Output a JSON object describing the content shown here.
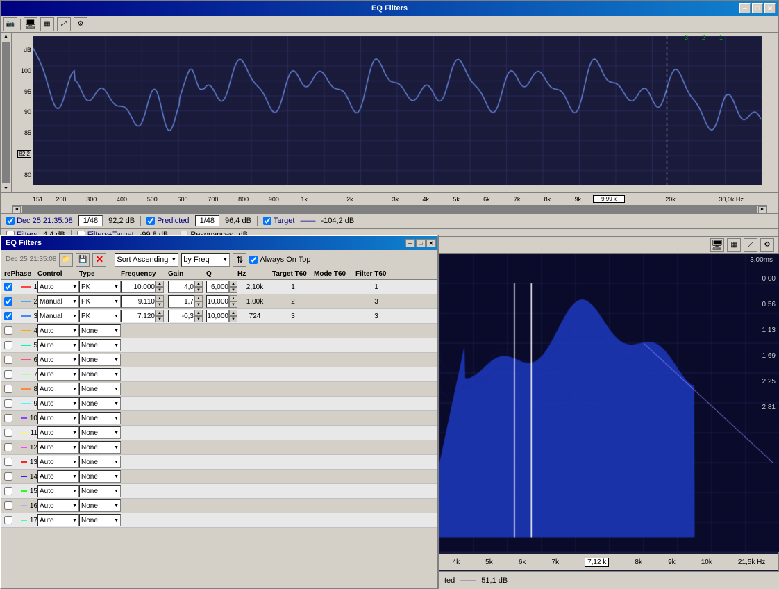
{
  "mainWindow": {
    "title": "EQ Filters",
    "toolbar": {
      "icons": [
        "camera",
        "restore",
        "maximize"
      ]
    },
    "chart": {
      "yAxis": {
        "label": "dB",
        "values": [
          100,
          95,
          90,
          85,
          80
        ]
      },
      "xAxis": {
        "values": [
          "151",
          "200",
          "300",
          "400",
          "500",
          "600",
          "700",
          "800",
          "900",
          "1k",
          "2k",
          "3k",
          "4k",
          "5k",
          "6k",
          "7k",
          "8k",
          "9k",
          "9,99k",
          "20k",
          "30,0k Hz"
        ]
      },
      "topMarkers": [
        "3",
        "2",
        "1"
      ],
      "currentFreq": "9,99 k"
    },
    "checkboxRow1": {
      "dec25Label": "Dec 25 21:35:08",
      "smoothing1": "1/48",
      "value1": "92,2 dB",
      "predictedLabel": "Predicted",
      "smoothing2": "1/48",
      "value2": "96,4 dB",
      "targetLabel": "Target",
      "line": "—",
      "value3": "-104,2 dB"
    },
    "checkboxRow2": {
      "filtersLabel": "Filters",
      "value4": "4,4 dB",
      "filtersTargetLabel": "Filters+Target",
      "value5": "-99,8 dB",
      "resonancesLabel": "Resonances",
      "value6": "dB"
    }
  },
  "eqWindow": {
    "title": "EQ Filters",
    "date": "Dec 25 21:35:08",
    "toolbar": {
      "sortLabel": "Sort Ascending",
      "byLabel": "by Freq",
      "alwaysOnTopLabel": "Always On Top"
    },
    "headers": {
      "rePhase": "rePhase",
      "control": "Control",
      "type": "Type",
      "frequency": "Frequency",
      "gain": "Gain",
      "q": "Q",
      "hz": "Hz",
      "targetT60": "Target T60",
      "modeT60": "Mode T60",
      "filterT60": "Filter T60"
    },
    "filters": [
      {
        "num": 1,
        "color": "#ff4444",
        "checked": true,
        "control": "Auto",
        "type": "PK",
        "frequency": "10.000",
        "gain": "4,0",
        "q": "6,000",
        "hz": "2,10k",
        "targetT60": "1",
        "modeT60": "",
        "filterT60": "1"
      },
      {
        "num": 2,
        "color": "#44aaff",
        "checked": true,
        "control": "Manual",
        "type": "PK",
        "frequency": "9.110",
        "gain": "1,7",
        "q": "10,000",
        "hz": "1,00k",
        "targetT60": "2",
        "modeT60": "",
        "filterT60": "3"
      },
      {
        "num": 3,
        "color": "#4488ff",
        "checked": true,
        "control": "Manual",
        "type": "PK",
        "frequency": "7.120",
        "gain": "-0,3",
        "q": "10,000",
        "hz": "724",
        "targetT60": "3",
        "modeT60": "",
        "filterT60": "3"
      },
      {
        "num": 4,
        "color": "#ffaa00",
        "checked": false,
        "control": "Auto",
        "type": "None",
        "frequency": "",
        "gain": "",
        "q": "",
        "hz": "",
        "targetT60": "",
        "modeT60": "",
        "filterT60": ""
      },
      {
        "num": 5,
        "color": "#00ffaa",
        "checked": false,
        "control": "Auto",
        "type": "None",
        "frequency": "",
        "gain": "",
        "q": "",
        "hz": "",
        "targetT60": "",
        "modeT60": "",
        "filterT60": ""
      },
      {
        "num": 6,
        "color": "#ff44aa",
        "checked": false,
        "control": "Auto",
        "type": "None",
        "frequency": "",
        "gain": "",
        "q": "",
        "hz": "",
        "targetT60": "",
        "modeT60": "",
        "filterT60": ""
      },
      {
        "num": 7,
        "color": "#aaffaa",
        "checked": false,
        "control": "Auto",
        "type": "None",
        "frequency": "",
        "gain": "",
        "q": "",
        "hz": "",
        "targetT60": "",
        "modeT60": "",
        "filterT60": ""
      },
      {
        "num": 8,
        "color": "#ff8844",
        "checked": false,
        "control": "Auto",
        "type": "None",
        "frequency": "",
        "gain": "",
        "q": "",
        "hz": "",
        "targetT60": "",
        "modeT60": "",
        "filterT60": ""
      },
      {
        "num": 9,
        "color": "#44ffff",
        "checked": false,
        "control": "Auto",
        "type": "None",
        "frequency": "",
        "gain": "",
        "q": "",
        "hz": "",
        "targetT60": "",
        "modeT60": "",
        "filterT60": ""
      },
      {
        "num": 10,
        "color": "#8844ff",
        "checked": false,
        "control": "Auto",
        "type": "None",
        "frequency": "",
        "gain": "",
        "q": "",
        "hz": "",
        "targetT60": "",
        "modeT60": "",
        "filterT60": ""
      },
      {
        "num": 11,
        "color": "#ffff44",
        "checked": false,
        "control": "Auto",
        "type": "None",
        "frequency": "",
        "gain": "",
        "q": "",
        "hz": "",
        "targetT60": "",
        "modeT60": "",
        "filterT60": ""
      },
      {
        "num": 12,
        "color": "#ff44ff",
        "checked": false,
        "control": "Auto",
        "type": "None",
        "frequency": "",
        "gain": "",
        "q": "",
        "hz": "",
        "targetT60": "",
        "modeT60": "",
        "filterT60": ""
      },
      {
        "num": 13,
        "color": "#ff2222",
        "checked": false,
        "control": "Auto",
        "type": "None",
        "frequency": "",
        "gain": "",
        "q": "",
        "hz": "",
        "targetT60": "",
        "modeT60": "",
        "filterT60": ""
      },
      {
        "num": 14,
        "color": "#2222ff",
        "checked": false,
        "control": "Auto",
        "type": "None",
        "frequency": "",
        "gain": "",
        "q": "",
        "hz": "",
        "targetT60": "",
        "modeT60": "",
        "filterT60": ""
      },
      {
        "num": 15,
        "color": "#22ff22",
        "checked": false,
        "control": "Auto",
        "type": "None",
        "frequency": "",
        "gain": "",
        "q": "",
        "hz": "",
        "targetT60": "",
        "modeT60": "",
        "filterT60": ""
      },
      {
        "num": 16,
        "color": "#aaaaff",
        "checked": false,
        "control": "Auto",
        "type": "None",
        "frequency": "",
        "gain": "",
        "q": "",
        "hz": "",
        "targetT60": "",
        "modeT60": "",
        "filterT60": ""
      },
      {
        "num": 17,
        "color": "#44ffaa",
        "checked": false,
        "control": "Auto",
        "type": "None",
        "frequency": "",
        "gain": "",
        "q": "",
        "hz": "",
        "targetT60": "",
        "modeT60": "",
        "filterT60": ""
      }
    ]
  },
  "rightPanel": {
    "timeLabel": "3,00ms",
    "sideLabels": [
      "0,00",
      "0,56",
      "1,13",
      "1,69",
      "2,25",
      "2,81"
    ],
    "bottomFreqs": [
      "4k",
      "5k",
      "6k",
      "7k",
      "8k",
      "9k",
      "10k",
      "21,5k Hz"
    ],
    "highlightedFreq": "7,12 k",
    "bottomStatus": {
      "label": "ted",
      "line": "——",
      "value": "51,1 dB"
    }
  },
  "icons": {
    "camera": "📷",
    "folder": "📁",
    "save": "💾",
    "close": "✕",
    "minimize": "─",
    "maximize": "□",
    "restore": "🗗",
    "gear": "⚙",
    "exchange": "⇅",
    "spinUp": "▲",
    "spinDown": "▼",
    "dropDown": "▼",
    "scrollUp": "▲",
    "scrollDown": "▼"
  }
}
